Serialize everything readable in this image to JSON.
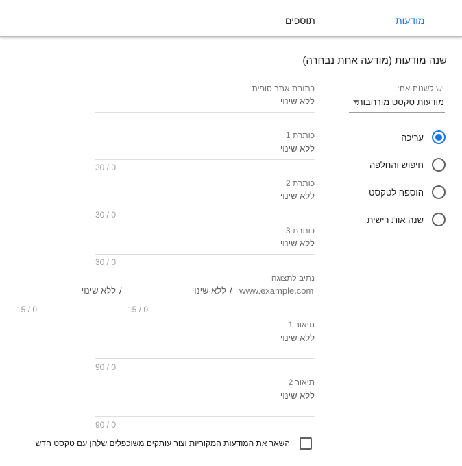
{
  "tabs": {
    "ads": "מודעות",
    "extensions": "תוספים"
  },
  "section_title": "שנה מודעות (מודעה אחת נבחרה)",
  "change_select": {
    "label": "יש לשנות את:",
    "value": "מודעות טקסט מורחבות"
  },
  "actions": [
    {
      "label": "עריכה",
      "selected": true
    },
    {
      "label": "חיפוש והחלפה",
      "selected": false
    },
    {
      "label": "הוספה לטקסט",
      "selected": false
    },
    {
      "label": "שנה אות רישית",
      "selected": false
    }
  ],
  "fields": {
    "final_url": {
      "label": "כתובת אתר סופית",
      "value": "ללא שינוי"
    },
    "headline1": {
      "label": "כותרת 1",
      "value": "ללא שינוי",
      "count": "30 / 0"
    },
    "headline2": {
      "label": "כותרת 2",
      "value": "ללא שינוי",
      "count": "30 / 0"
    },
    "headline3": {
      "label": "כותרת 3",
      "value": "ללא שינוי",
      "count": "30 / 0"
    },
    "description1": {
      "label": "תיאור 1",
      "value": "ללא שינוי",
      "count": "90 / 0"
    },
    "description2": {
      "label": "תיאור 2",
      "value": "ללא שינוי",
      "count": "90 / 0"
    }
  },
  "display_path": {
    "label": "נתיב לתצוגה",
    "domain": "www.example.com",
    "slash": "/",
    "path1": "ללא שינוי",
    "path2": "ללא שינוי",
    "count1": "15 / 0",
    "count2": "15 / 0"
  },
  "keep_original": {
    "label": "השאר את המודעות המקוריות וצור עותקים משוכפלים שלהן עם טקסט חדש",
    "checked": false
  },
  "colors": {
    "accent": "#1a73e8",
    "text": "#212121",
    "muted": "#757575"
  }
}
